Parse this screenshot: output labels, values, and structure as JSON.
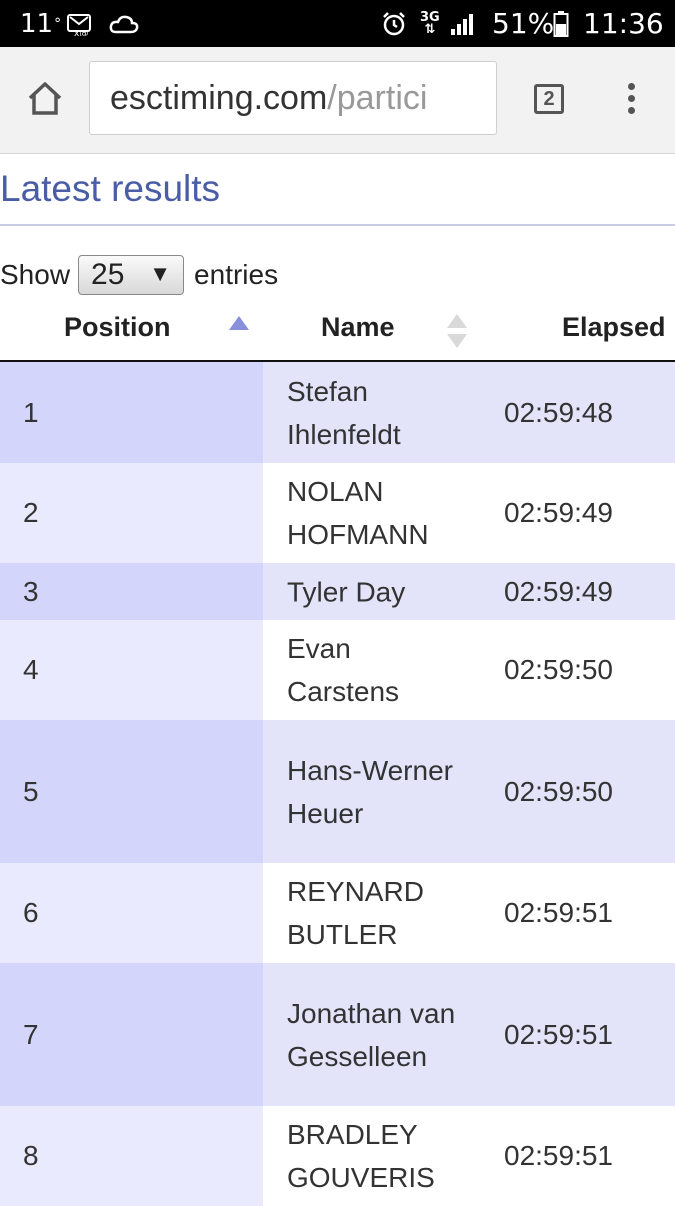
{
  "status_bar": {
    "temperature": "11",
    "battery_percent": "51%",
    "time": "11:36",
    "network": "3G"
  },
  "browser": {
    "url_domain": "esctiming.com",
    "url_path": "/partici",
    "tab_count": "2"
  },
  "page": {
    "title": "Latest results",
    "show_label": "Show",
    "entries_value": "25",
    "entries_label": "entries"
  },
  "table": {
    "columns": [
      "Position",
      "Name",
      "Elapsed"
    ],
    "sort_column": "Position",
    "rows": [
      {
        "position": "1",
        "name": "Stefan Ihlenfeldt",
        "elapsed": "02:59:48"
      },
      {
        "position": "2",
        "name": "NOLAN HOFMANN",
        "elapsed": "02:59:49"
      },
      {
        "position": "3",
        "name": "Tyler Day",
        "elapsed": "02:59:49"
      },
      {
        "position": "4",
        "name": "Evan Carstens",
        "elapsed": "02:59:50"
      },
      {
        "position": "5",
        "name": "Hans-Werner Heuer",
        "elapsed": "02:59:50"
      },
      {
        "position": "6",
        "name": "REYNARD BUTLER",
        "elapsed": "02:59:51"
      },
      {
        "position": "7",
        "name": "Jonathan van Gesselleen",
        "elapsed": "02:59:51"
      },
      {
        "position": "8",
        "name": "BRADLEY GOUVERIS",
        "elapsed": "02:59:51"
      }
    ]
  },
  "colors": {
    "title": "#4a5ea6",
    "row_odd": "#e3e4fa",
    "row_odd_sorted": "#d3d6fa",
    "row_even_sorted": "#e9eafd",
    "sort_active": "#8790d9"
  }
}
